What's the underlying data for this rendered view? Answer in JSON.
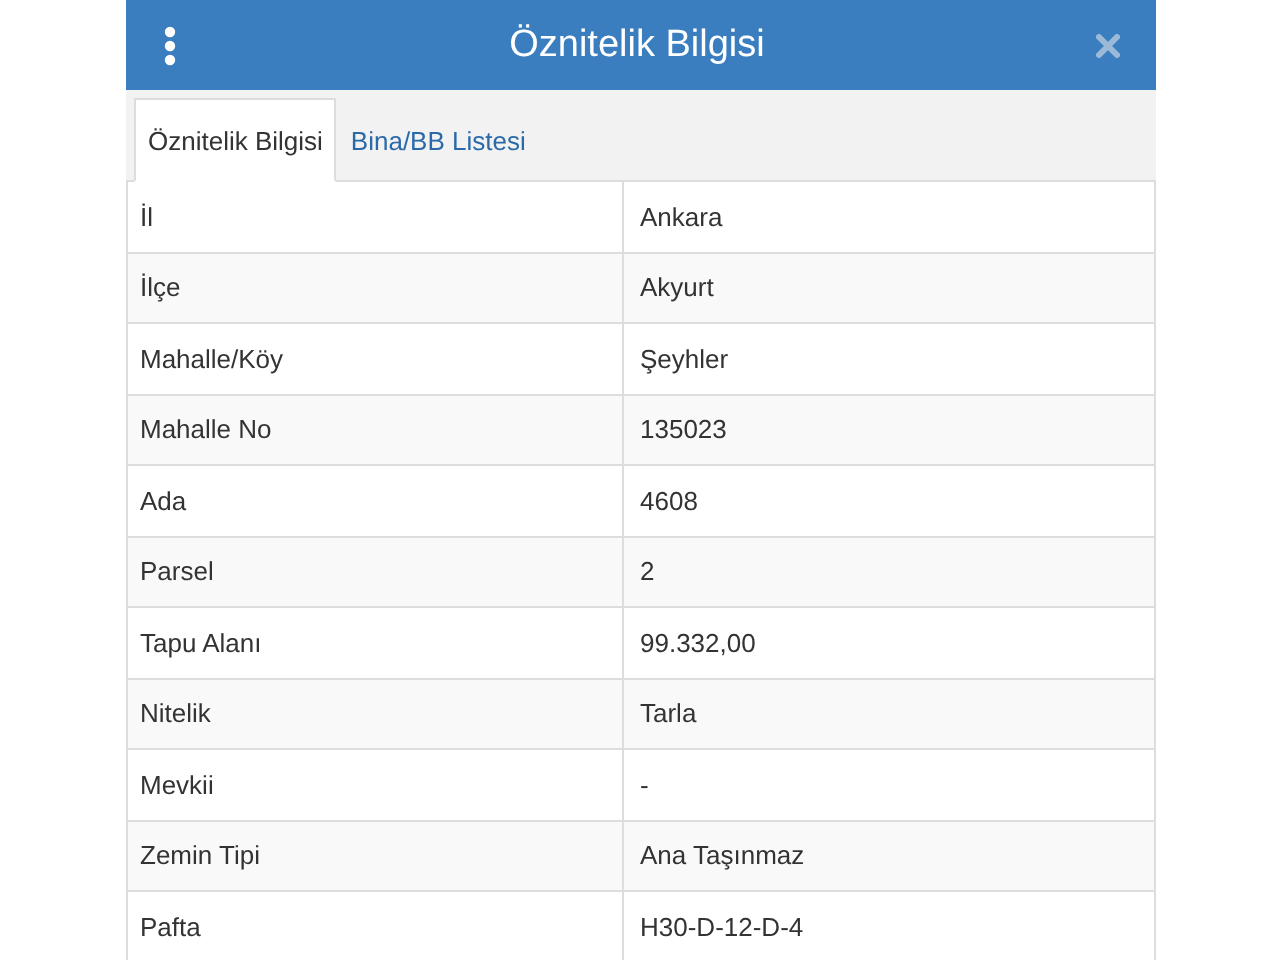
{
  "header": {
    "title": "Öznitelik Bilgisi"
  },
  "tabs": [
    {
      "label": "Öznitelik Bilgisi",
      "selected": true
    },
    {
      "label": "Bina/BB Listesi",
      "selected": false
    }
  ],
  "table": {
    "rows": [
      {
        "label": "İl",
        "value": "Ankara"
      },
      {
        "label": "İlçe",
        "value": "Akyurt"
      },
      {
        "label": "Mahalle/Köy",
        "value": "Şeyhler"
      },
      {
        "label": "Mahalle No",
        "value": "135023"
      },
      {
        "label": "Ada",
        "value": "4608"
      },
      {
        "label": "Parsel",
        "value": "2"
      },
      {
        "label": "Tapu Alanı",
        "value": "99.332,00"
      },
      {
        "label": "Nitelik",
        "value": "Tarla"
      },
      {
        "label": "Mevkii",
        "value": "-"
      },
      {
        "label": "Zemin Tipi",
        "value": "Ana Taşınmaz"
      },
      {
        "label": "Pafta",
        "value": "H30-D-12-D-4"
      }
    ]
  }
}
